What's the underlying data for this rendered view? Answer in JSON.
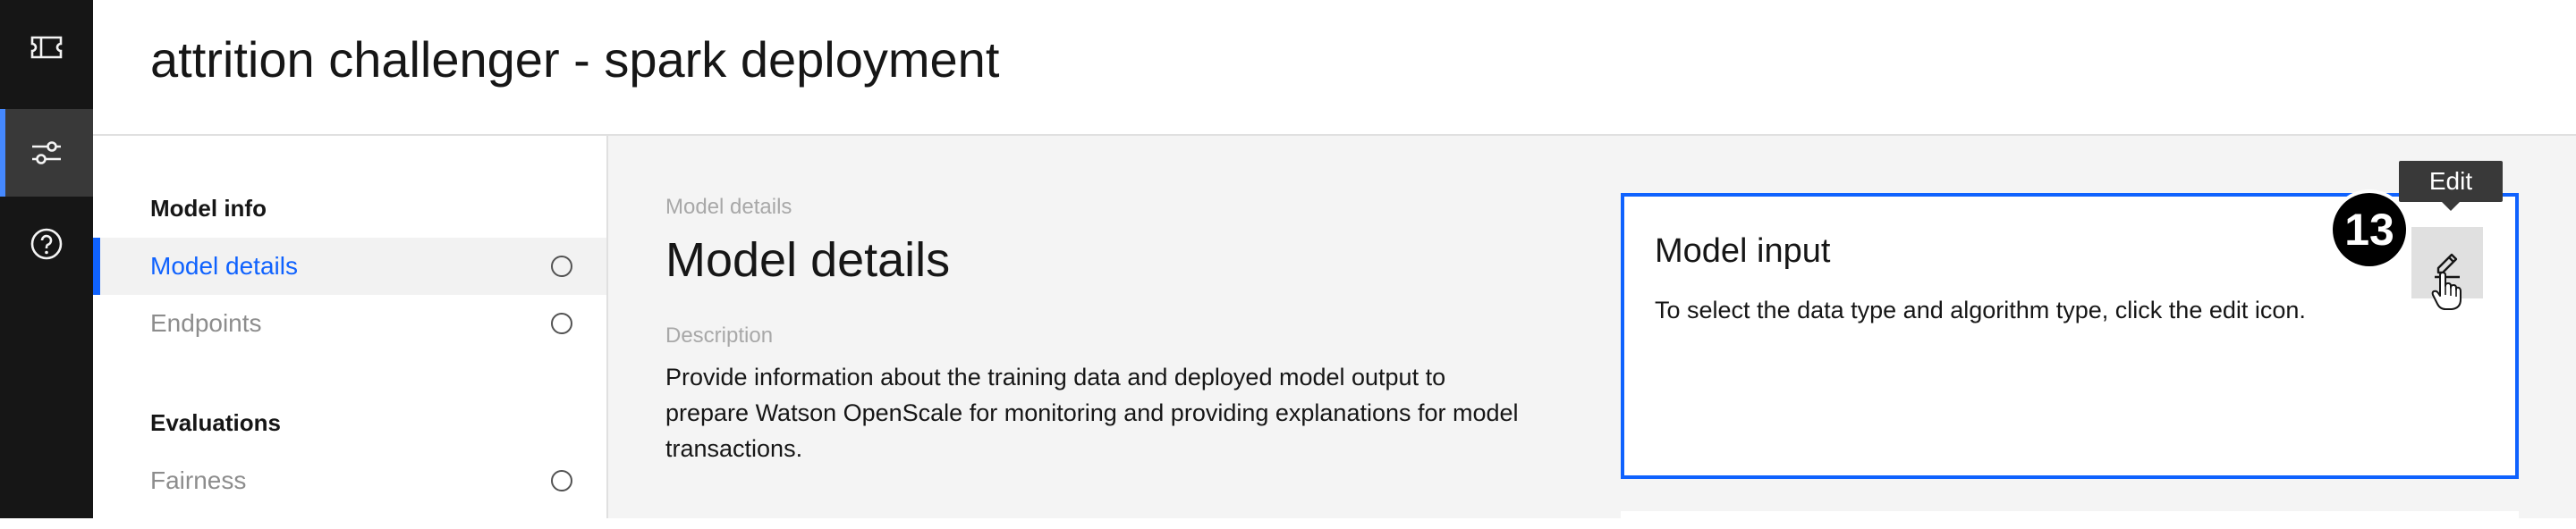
{
  "header": {
    "title": "attrition challenger - spark deployment"
  },
  "rail": {
    "items": [
      {
        "icon": "ticket-icon",
        "active": false
      },
      {
        "icon": "sliders-icon",
        "active": true
      },
      {
        "icon": "help-icon",
        "active": false
      }
    ]
  },
  "nav": {
    "sections": [
      {
        "title": "Model info",
        "items": [
          {
            "label": "Model details",
            "active": true
          },
          {
            "label": "Endpoints",
            "active": false
          }
        ]
      },
      {
        "title": "Evaluations",
        "items": [
          {
            "label": "Fairness",
            "active": false
          }
        ]
      }
    ]
  },
  "main": {
    "breadcrumb": "Model details",
    "title": "Model details",
    "description_label": "Description",
    "description": "Provide information about the training data and deployed model output to prepare Watson OpenScale for monitoring and providing explanations for model transactions."
  },
  "model_input": {
    "title": "Model input",
    "text": "To select the data type and algorithm type, click the edit icon.",
    "edit_tooltip": "Edit"
  },
  "step_badge": "13",
  "colors": {
    "accent": "#0f62fe",
    "rail": "#161616",
    "main_bg": "#f4f4f4"
  }
}
